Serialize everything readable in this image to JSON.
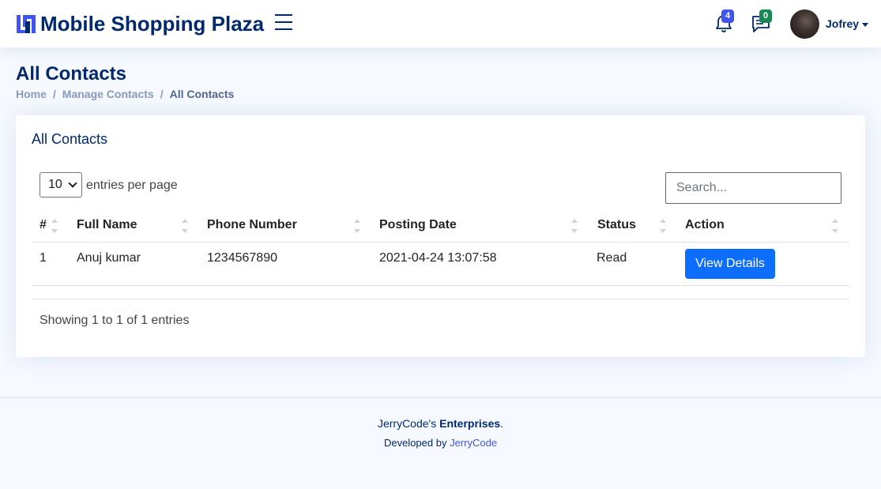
{
  "header": {
    "brand": "Mobile Shopping Plaza",
    "notifications_count": "4",
    "messages_count": "0",
    "user_name": "Jofrey",
    "icons": [
      "logo-mark",
      "menu-icon",
      "bell-icon",
      "chat-icon",
      "caret-down-icon"
    ]
  },
  "page": {
    "title": "All Contacts",
    "breadcrumb": [
      "Home",
      "Manage Contacts",
      "All Contacts"
    ],
    "separator": "/"
  },
  "card": {
    "title": "All Contacts",
    "entries_value": "10",
    "entries_label": "entries per page",
    "search_placeholder": "Search...",
    "columns": [
      "#",
      "Full Name",
      "Phone Number",
      "Posting Date",
      "Status",
      "Action"
    ],
    "rows": [
      {
        "num": "1",
        "full_name": "Anuj kumar",
        "phone": "1234567890",
        "posting_date": "2021-04-24 13:07:58",
        "status": "Read",
        "action": "View Details"
      }
    ],
    "info": "Showing 1 to 1 of 1 entries"
  },
  "footer": {
    "copy_prefix": "JerryCode's ",
    "copy_bold": "Enterprises",
    "copy_suffix": ".",
    "dev_prefix": "Developed by ",
    "dev_link": "JerryCode"
  },
  "colors": {
    "brand": "#012970",
    "accent": "#4154f1",
    "primary_button": "#0d6efd",
    "success_badge": "#198754",
    "background": "#f6f9ff"
  }
}
